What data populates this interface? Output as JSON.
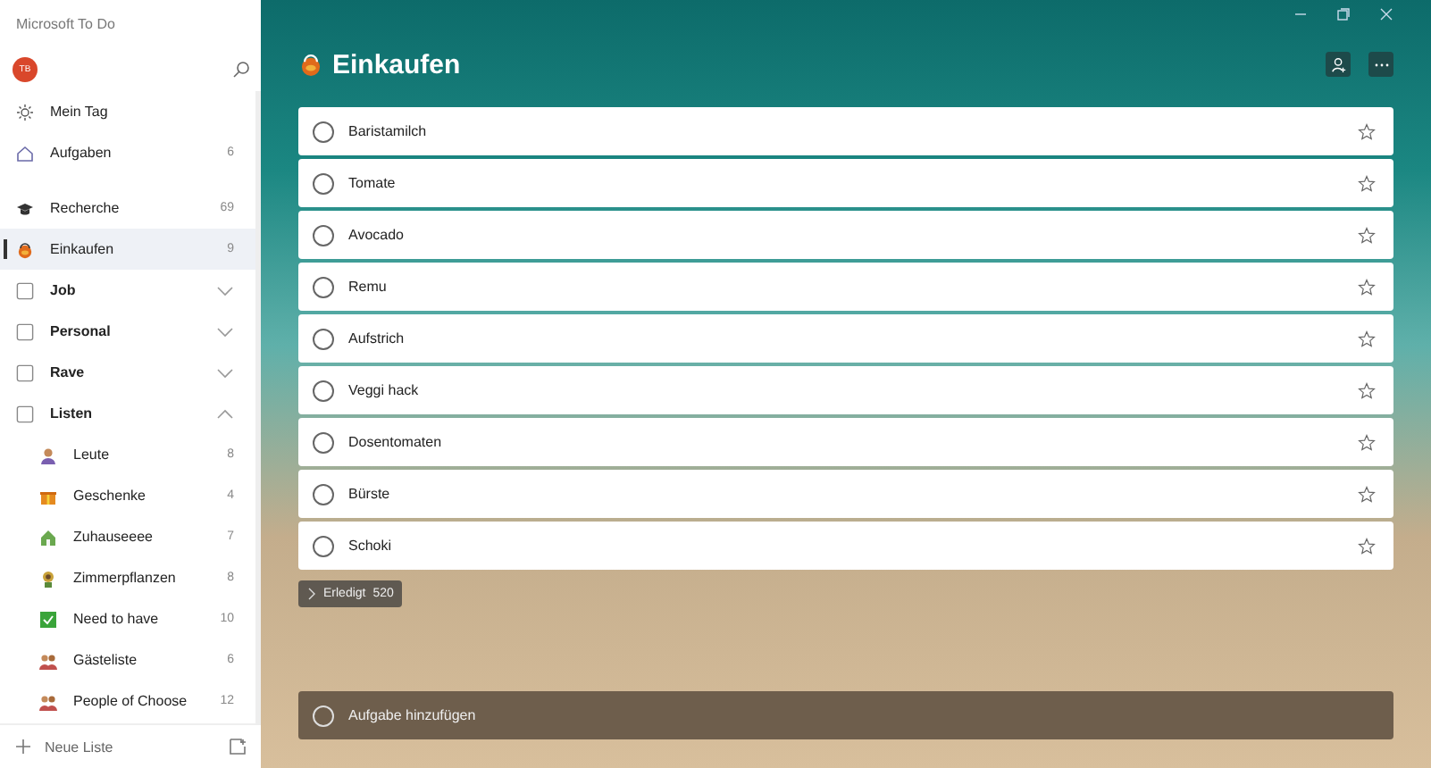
{
  "window": {
    "title": "Microsoft To Do"
  },
  "sidebar": {
    "avatar": "TB",
    "items": [
      {
        "kind": "smart",
        "label": "Mein Tag",
        "selected": false
      },
      {
        "kind": "smart",
        "label": "Aufgaben",
        "count": "6",
        "selected": false
      },
      {
        "kind": "spacer"
      },
      {
        "kind": "list",
        "label": "Recherche",
        "count": "69",
        "selected": false
      },
      {
        "kind": "list",
        "label": "Einkaufen",
        "count": "9",
        "selected": true
      },
      {
        "kind": "group",
        "label": "Job",
        "expanded": false
      },
      {
        "kind": "group",
        "label": "Personal",
        "expanded": false
      },
      {
        "kind": "group",
        "label": "Rave",
        "expanded": false
      },
      {
        "kind": "group",
        "label": "Listen",
        "expanded": true,
        "children": [
          {
            "label": "Leute",
            "count": "8",
            "selected": false
          },
          {
            "label": "Geschenke",
            "count": "4",
            "selected": false
          },
          {
            "label": "Zuhauseeee",
            "count": "7",
            "selected": false
          },
          {
            "label": "Zimmerpflanzen",
            "count": "8",
            "selected": false
          },
          {
            "label": "Need to have",
            "count": "10",
            "selected": false
          },
          {
            "label": "Gästeliste",
            "count": "6",
            "selected": false
          },
          {
            "label": "People of Choose",
            "count": "12",
            "selected": false
          }
        ]
      }
    ],
    "new_list": "Neue Liste"
  },
  "main": {
    "title": "Einkaufen",
    "tasks": [
      {
        "title": "Baristamilch",
        "completed": false,
        "important": false
      },
      {
        "title": "Tomate",
        "completed": false,
        "important": false
      },
      {
        "title": "Avocado",
        "completed": false,
        "important": false
      },
      {
        "title": "Remu",
        "completed": false,
        "important": false
      },
      {
        "title": "Aufstrich",
        "completed": false,
        "important": false
      },
      {
        "title": "Veggi hack",
        "completed": false,
        "important": false
      },
      {
        "title": "Dosentomaten",
        "completed": false,
        "important": false
      },
      {
        "title": "Bürste",
        "completed": false,
        "important": false
      },
      {
        "title": "Schoki",
        "completed": false,
        "important": false
      }
    ],
    "completed_toggle": {
      "label": "Erledigt",
      "count": "520",
      "expanded": false
    },
    "add_task": {
      "placeholder": "Aufgabe hinzufügen"
    }
  }
}
